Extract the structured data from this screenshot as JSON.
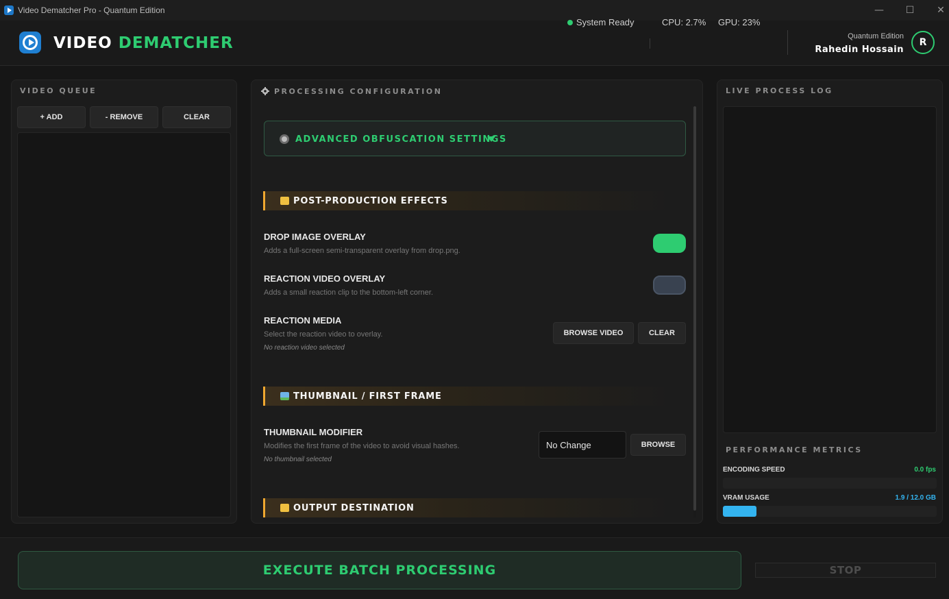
{
  "window": {
    "title": "Video Dematcher Pro - Quantum Edition",
    "controls": {
      "minimize": "—",
      "maximize": "☐",
      "close": "✕"
    }
  },
  "header": {
    "brand_white": "VIDEO",
    "brand_green": "DEMATCHER",
    "status_text": "System Ready",
    "status_color": "#2ecc71",
    "cpu": "CPU: 2.7%",
    "gpu": "GPU: 23%",
    "edition": "Quantum Edition",
    "user_name": "Rahedin Hossain",
    "avatar_initial": "R"
  },
  "queue": {
    "title": "VIDEO QUEUE",
    "add_label": "+ ADD",
    "remove_label": "- REMOVE",
    "clear_label": "CLEAR"
  },
  "config": {
    "title": "PROCESSING CONFIGURATION",
    "advanced_label": "ADVANCED OBFUSCATION SETTINGS",
    "sections": {
      "post": "POST-PRODUCTION EFFECTS",
      "thumb": "THUMBNAIL / FIRST FRAME",
      "output": "OUTPUT DESTINATION"
    },
    "drop_overlay": {
      "title": "DROP IMAGE OVERLAY",
      "desc": "Adds a full-screen semi-transparent overlay from drop.png.",
      "enabled": true
    },
    "reaction_overlay": {
      "title": "REACTION VIDEO OVERLAY",
      "desc": "Adds a small reaction clip to the bottom-left corner.",
      "enabled": false
    },
    "reaction_media": {
      "title": "REACTION MEDIA",
      "desc": "Select the reaction video to overlay.",
      "note": "No reaction video selected",
      "browse_label": "BROWSE VIDEO",
      "clear_label": "CLEAR"
    },
    "thumbnail": {
      "title": "THUMBNAIL MODIFIER",
      "desc": "Modifies the first frame of the video to avoid visual hashes.",
      "note": "No thumbnail selected",
      "select_value": "No Change",
      "browse_label": "BROWSE"
    }
  },
  "log": {
    "title": "LIVE PROCESS LOG",
    "metrics_title": "PERFORMANCE METRICS",
    "encoding_label": "ENCODING SPEED",
    "encoding_value": "0.0 fps",
    "encoding_color": "#2ecc71",
    "encoding_fraction": 0,
    "vram_label": "VRAM USAGE",
    "vram_value": "1.9 / 12.0 GB",
    "vram_color": "#33b4f0",
    "vram_fraction": 0.158
  },
  "footer": {
    "execute_label": "EXECUTE BATCH PROCESSING",
    "stop_label": "STOP"
  }
}
